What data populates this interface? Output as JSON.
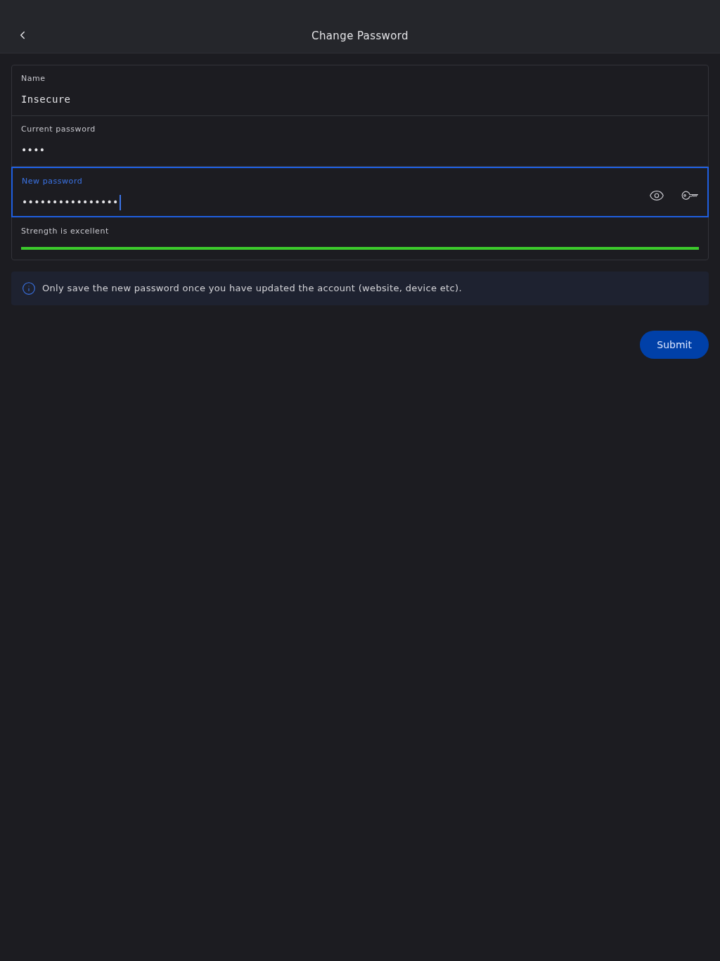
{
  "header": {
    "title": "Change Password"
  },
  "fields": [
    {
      "label": "Name",
      "value": "Insecure",
      "focused": false,
      "kind": "text"
    },
    {
      "label": "Current password",
      "value": "••••",
      "focused": false,
      "kind": "password"
    },
    {
      "label": "New password",
      "value": "••••••••••••••••",
      "focused": true,
      "kind": "password_tools"
    }
  ],
  "strength": {
    "label": "Strength is excellent",
    "level": 1.0
  },
  "notice": "Only save the new password once you have updated the account (website, device etc).",
  "submit": "Submit"
}
